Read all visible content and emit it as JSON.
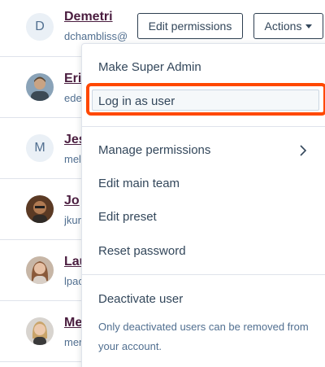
{
  "users": [
    {
      "initial": "D",
      "name": "Demetri",
      "email": "dchambliss@",
      "avatar_type": "initial"
    },
    {
      "initial": "",
      "name": "Eri",
      "email": "ede",
      "avatar_type": "photo"
    },
    {
      "initial": "M",
      "name": "Jes",
      "email": "mel",
      "avatar_type": "initial"
    },
    {
      "initial": "",
      "name": "Jo",
      "email": "jkur",
      "avatar_type": "photo"
    },
    {
      "initial": "",
      "name": "Lau",
      "email": "lpac",
      "avatar_type": "photo"
    },
    {
      "initial": "",
      "name": "Me",
      "email": "mer",
      "avatar_type": "photo"
    }
  ],
  "row_buttons": {
    "edit_permissions": "Edit permissions",
    "actions": "Actions"
  },
  "actions_menu": {
    "make_super_admin": "Make Super Admin",
    "log_in_as_user": "Log in as user",
    "manage_permissions": "Manage permissions",
    "edit_main_team": "Edit main team",
    "edit_preset": "Edit preset",
    "reset_password": "Reset password",
    "deactivate_user": "Deactivate user",
    "deactivate_note": "Only deactivated users can be removed from your account."
  },
  "colors": {
    "name_link": "#4a1d3f",
    "highlight": "#ff4800",
    "text": "#33475b"
  }
}
